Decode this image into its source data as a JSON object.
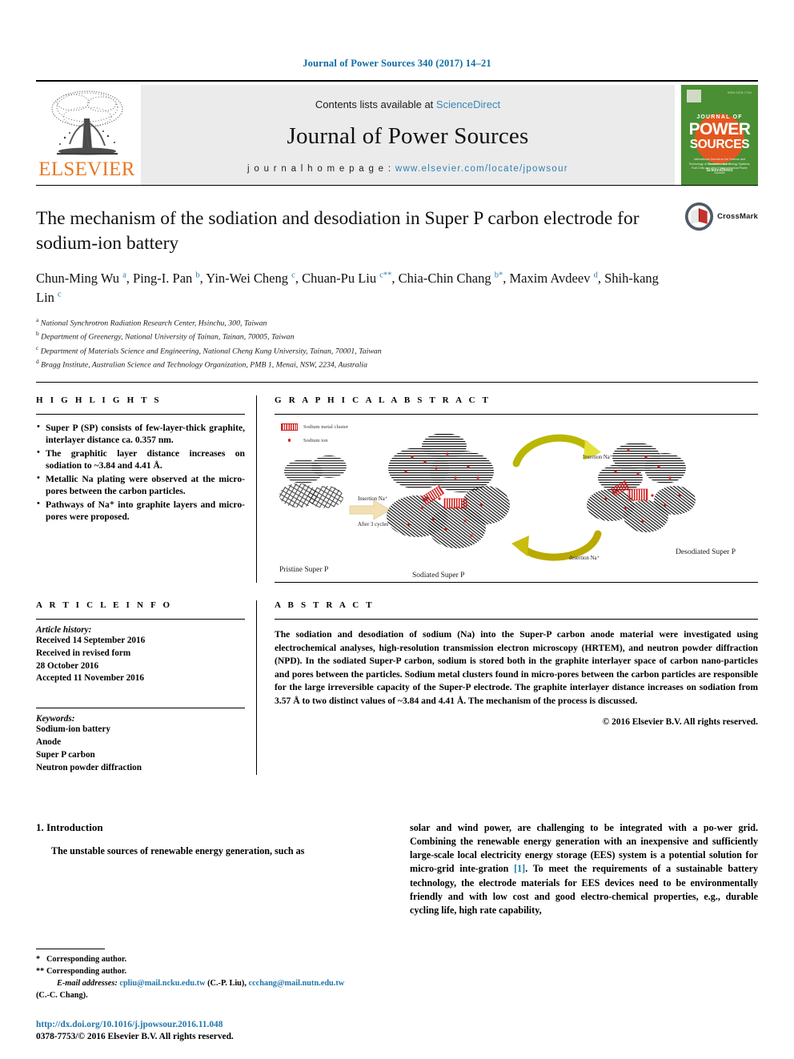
{
  "running_head": "Journal of Power Sources 340 (2017) 14–21",
  "masthead": {
    "publisher_name": "ELSEVIER",
    "contents_prefix": "Contents lists available at ",
    "contents_link": "ScienceDirect",
    "journal_name": "Journal of Power Sources",
    "homepage_prefix": "j o u r n a l   h o m e p a g e :  ",
    "homepage_url": "www.elsevier.com/locate/jpowsour",
    "cover": {
      "kicker": "JOURNAL OF",
      "title_line1": "POWER",
      "title_line2": "SOURCES",
      "blurb": "International Journal on the Science and Technology of Electrochemical Energy Systems, Fuel Cells and other Electrochemical Power Sources",
      "footer_small": "Available online at",
      "footer_brand": "ScienceDirect"
    }
  },
  "article": {
    "title": "The mechanism of the sodiation and desodiation in Super P carbon electrode for sodium-ion battery",
    "crossmark_label": "CrossMark",
    "authors_html": "Chun-Ming Wu <sup>a</sup>, Ping-I. Pan <sup>b</sup>, Yin-Wei Cheng <sup>c</sup>, Chuan-Pu Liu <sup>c</sup><sup class=\"star\">**</sup>, Chia-Chin Chang <sup>b</sup><sup class=\"star\">*</sup>, Maxim Avdeev <sup>d</sup>, Shih-kang Lin <sup>c</sup>",
    "affiliations": [
      {
        "mark": "a",
        "text": "National Synchrotron Radiation Research Center, Hsinchu, 300, Taiwan"
      },
      {
        "mark": "b",
        "text": "Department of Greenergy, National University of Tainan, Tainan, 70005, Taiwan"
      },
      {
        "mark": "c",
        "text": "Department of Materials Science and Engineering, National Cheng Kung University, Tainan, 70001, Taiwan"
      },
      {
        "mark": "d",
        "text": "Bragg Institute, Australian Science and Technology Organization, PMB 1, Menai, NSW, 2234, Australia"
      }
    ]
  },
  "highlights": {
    "heading": "H I G H L I G H T S",
    "items": [
      "Super P (SP) consists of few-layer-thick graphite, interlayer distance ca. 0.357 nm.",
      "The graphitic layer distance increases on sodiation to ~3.84 and 4.41 Å.",
      "Metallic Na plating were observed at the micro-pores between the carbon particles.",
      "Pathways of Na⁺ into graphite layers and micro-pores were proposed."
    ]
  },
  "graphical_abstract": {
    "heading": "G R A P H I C A L   A B S T R A C T",
    "legend": [
      {
        "icon": "sodium-metal-cluster-swatch",
        "label": "Sodium metal cluster"
      },
      {
        "icon": "sodium-ion-dot",
        "label": "Sodium ion"
      }
    ],
    "labels": {
      "pristine": "Pristine Super P",
      "sodiated": "Sodiated Super P",
      "desodiated": "Desodiated Super P",
      "insertion_left": "Insertion Na⁺",
      "after_cycles": "After 3 cycles",
      "insertion_top": "Insertion Na⁺",
      "desertion_bottom": "desertion Na⁺"
    }
  },
  "article_info": {
    "heading": "A R T I C L E   I N F O",
    "history_label": "Article history:",
    "history_lines": [
      "Received 14 September 2016",
      "Received in revised form",
      "28 October 2016",
      "Accepted 11 November 2016"
    ],
    "keywords_label": "Keywords:",
    "keywords": [
      "Sodium-ion battery",
      "Anode",
      "Super P carbon",
      "Neutron powder diffraction"
    ]
  },
  "abstract": {
    "heading": "A B S T R A C T",
    "text": "The sodiation and desodiation of sodium (Na) into the Super-P carbon anode material were investigated using electrochemical analyses, high-resolution transmission electron microscopy (HRTEM), and neutron powder diffraction (NPD). In the sodiated Super-P carbon, sodium is stored both in the graphite interlayer space of carbon nano-particles and pores between the particles. Sodium metal clusters found in micro-pores between the carbon particles are responsible for the large irreversible capacity of the Super-P electrode. The graphite interlayer distance increases on sodiation from 3.57 Å to two distinct values of ~3.84 and 4.41 Å. The mechanism of the process is discussed.",
    "copyright": "© 2016 Elsevier B.V. All rights reserved."
  },
  "body": {
    "section_number_title": "1.  Introduction",
    "left_para": "The unstable sources of renewable energy generation, such as",
    "right_para_1": "solar and wind power, are challenging to be integrated with a po-wer grid. Combining the renewable energy generation with an inexpensive and sufficiently large-scale local electricity energy storage (EES) system is a potential solution for micro-grid inte-gration ",
    "right_ref": "[1]",
    "right_para_2": ". To meet the requirements of a sustainable battery technology, the electrode materials for EES devices need to be environmentally friendly and with low cost and good electro-chemical properties, e.g., durable cycling life, high rate capability,"
  },
  "footnotes": {
    "star_mark": "*",
    "star_text": "Corresponding author.",
    "dstar_mark": "**",
    "dstar_text": "Corresponding author.",
    "email_label": "E-mail addresses:",
    "email_1": "cpliu@mail.ncku.edu.tw",
    "email_1_name": "(C.-P. Liu),",
    "email_2": "ccchang@mail.nutn.edu.tw",
    "email_2_name": "(C.-C. Chang).",
    "doi": "http://dx.doi.org/10.1016/j.jpowsour.2016.11.048",
    "issn": "0378-7753/© 2016 Elsevier B.V. All rights reserved."
  },
  "colors": {
    "link_blue": "#2176a8",
    "runhead_blue": "#0b6ca3",
    "elsevier_orange": "#e87722",
    "cover_green": "#4a8f34",
    "cover_sun": "#e2571f",
    "sodium_red": "#d01c1c",
    "arrow_yellow": "#c8c400",
    "arrow_cream": "#f2e0b4"
  }
}
